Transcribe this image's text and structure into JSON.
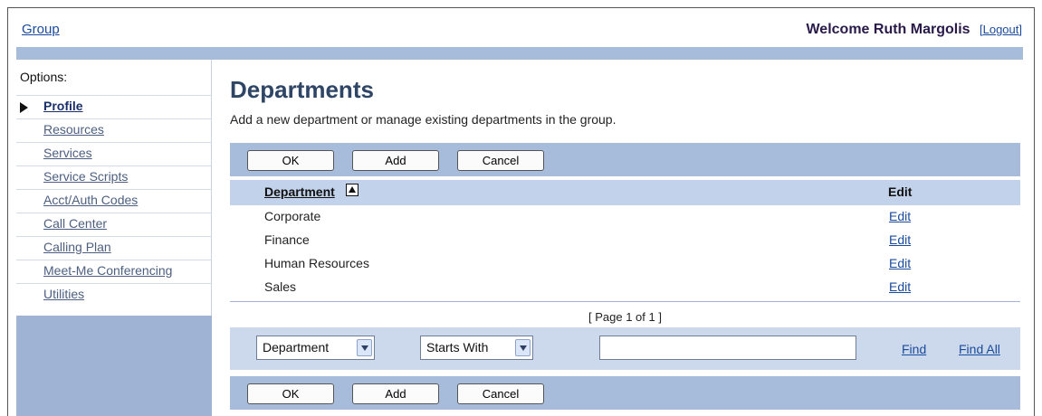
{
  "header": {
    "group_link": "Group",
    "welcome_text": "Welcome Ruth Margolis",
    "logout_label": "[Logout]"
  },
  "sidebar": {
    "options_label": "Options:",
    "items": [
      {
        "label": "Profile",
        "active": true
      },
      {
        "label": "Resources"
      },
      {
        "label": "Services"
      },
      {
        "label": "Service Scripts"
      },
      {
        "label": "Acct/Auth Codes"
      },
      {
        "label": "Call Center"
      },
      {
        "label": "Calling Plan"
      },
      {
        "label": "Meet-Me Conferencing"
      },
      {
        "label": "Utilities"
      }
    ]
  },
  "main": {
    "title": "Departments",
    "description": "Add a new department or manage existing departments in the group.",
    "buttons": {
      "ok": "OK",
      "add": "Add",
      "cancel": "Cancel"
    },
    "table": {
      "col_department": "Department",
      "col_edit": "Edit",
      "rows": [
        {
          "name": "Corporate",
          "edit": "Edit"
        },
        {
          "name": "Finance",
          "edit": "Edit"
        },
        {
          "name": "Human Resources",
          "edit": "Edit"
        },
        {
          "name": "Sales",
          "edit": "Edit"
        }
      ]
    },
    "pager": "[ Page 1 of 1 ]",
    "search": {
      "field_select": "Department",
      "mode_select": "Starts With",
      "input_value": "",
      "find_label": "Find",
      "find_all_label": "Find All"
    }
  }
}
